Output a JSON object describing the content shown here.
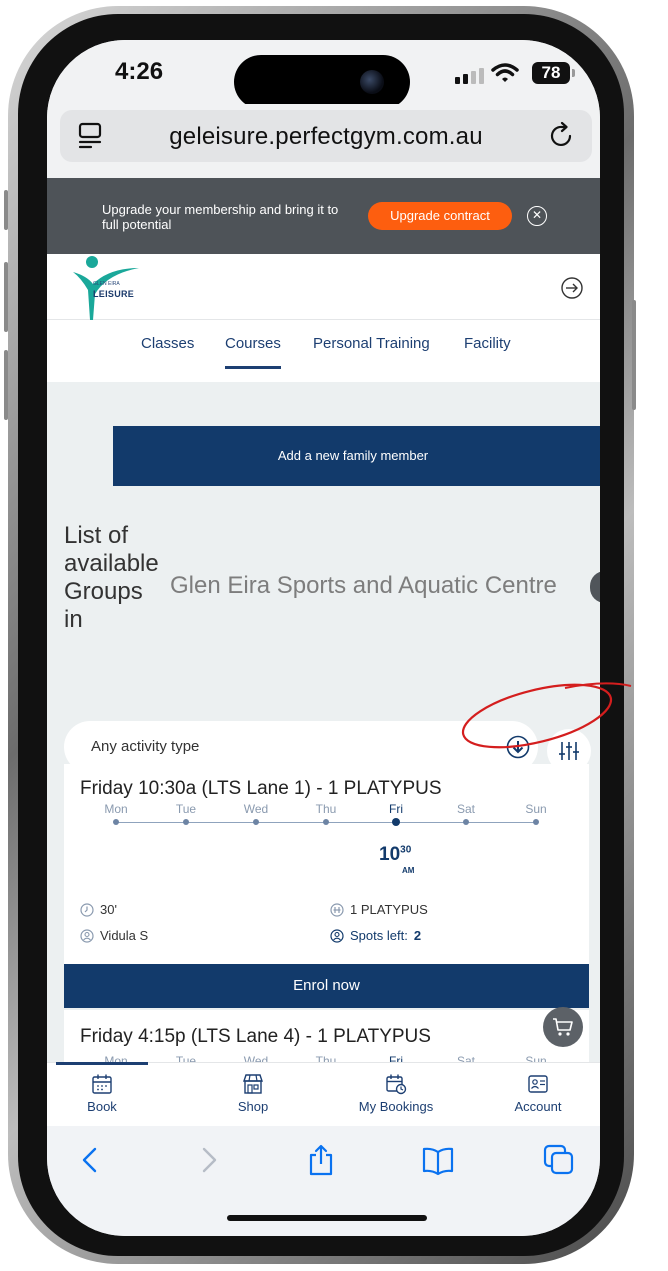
{
  "status": {
    "time": "4:26",
    "battery": "78"
  },
  "browser": {
    "url": "geleisure.perfectgym.com.au"
  },
  "banner": {
    "text": "Upgrade your membership and bring it to full potential",
    "button": "Upgrade contract"
  },
  "header": {
    "logo_small": "GLEN EIRA",
    "logo_main": "LEISURE"
  },
  "nav": {
    "tabs": [
      "Classes",
      "Courses",
      "Personal Training",
      "Facility"
    ],
    "active": "Courses"
  },
  "main": {
    "family_button": "Add a new family member",
    "heading": "List of available Groups in",
    "centre": "Glen Eira Sports and Aquatic Centre"
  },
  "filter": {
    "activity_placeholder": "Any activity type"
  },
  "days": [
    "Mon",
    "Tue",
    "Wed",
    "Thu",
    "Fri",
    "Sat",
    "Sun"
  ],
  "cards": [
    {
      "title": "Friday 10:30a (LTS Lane 1) - 1 PLATYPUS",
      "active_day": "Fri",
      "time_hour": "10",
      "time_min": "30",
      "time_period": "AM",
      "duration": "30'",
      "level": "1 PLATYPUS",
      "instructor": "Vidula S",
      "spots_label": "Spots left:",
      "spots_value": "2",
      "enrol": "Enrol now"
    },
    {
      "title": "Friday 4:15p (LTS Lane 4) - 1 PLATYPUS",
      "active_day": "Fri"
    }
  ],
  "app_nav": {
    "items": [
      "Book",
      "Shop",
      "My Bookings",
      "Account"
    ],
    "active": "Book"
  },
  "colors": {
    "brand": "#123a6b",
    "accent": "#fd5e0f",
    "annotation": "#d41e1e"
  }
}
